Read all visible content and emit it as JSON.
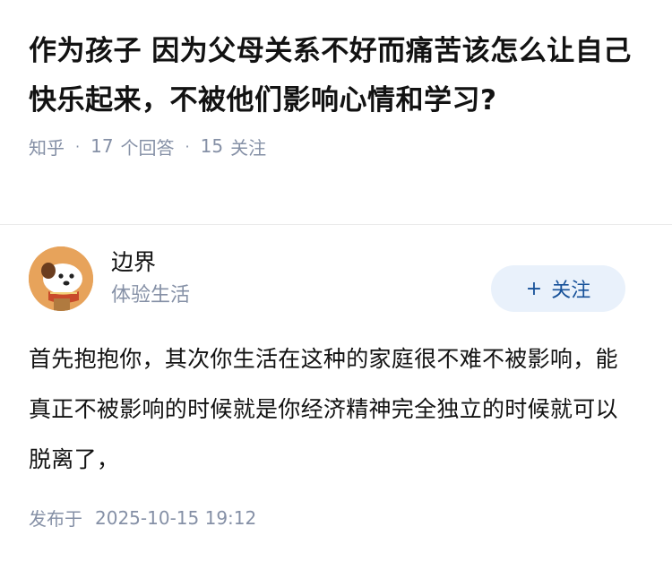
{
  "question": {
    "title": "作为孩子 因为父母关系不好而痛苦该怎么让自己快乐起来，不被他们影响心情和学习?",
    "source": "知乎",
    "answer_count": "17",
    "answer_label": "个回答",
    "follow_count": "15",
    "follow_label": "关注",
    "separator": "·"
  },
  "answer": {
    "author": {
      "name": "边界",
      "bio": "体验生活",
      "avatar_icon": "dog-cartoon-avatar"
    },
    "follow_button": {
      "plus": "+",
      "label": "关注"
    },
    "content": "首先抱抱你，其次你生活在这种的家庭很不难不被影响，能真正不被影响的时候就是你经济精神完全独立的时候就可以脱离了，",
    "publish_label": "发布于",
    "publish_time": "2025-10-15 19:12"
  },
  "colors": {
    "text": "#121212",
    "meta": "#8590a6",
    "accent": "#175199",
    "button_bg": "#e9f1fb",
    "divider": "#ebebeb"
  }
}
